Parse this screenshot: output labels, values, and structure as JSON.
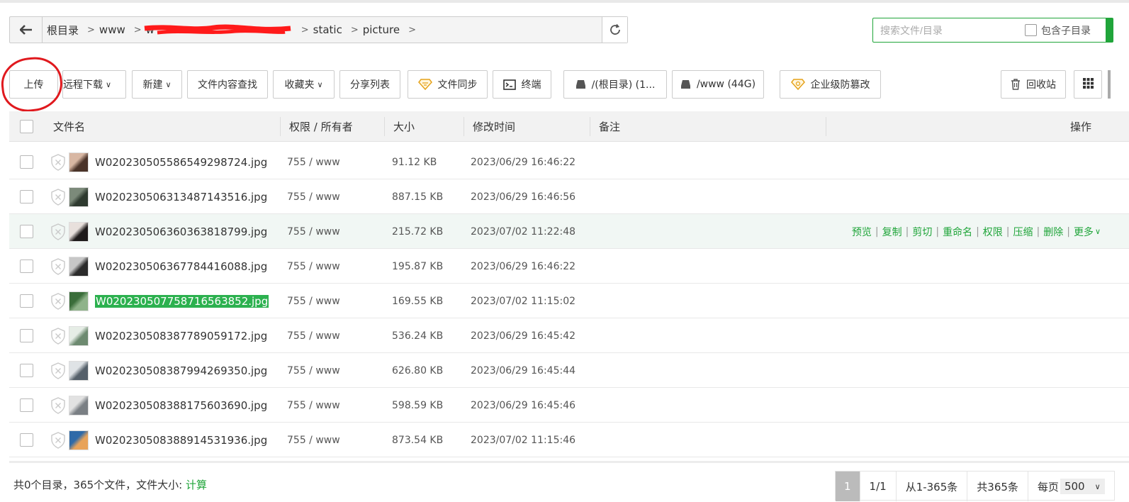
{
  "path": {
    "crumbs": [
      "根目录",
      "www",
      "w",
      "static",
      "picture"
    ]
  },
  "search": {
    "placeholder": "搜索文件/目录",
    "include_sub_label": "包含子目录"
  },
  "toolbar": {
    "upload": "上传",
    "remote_download": "远程下载",
    "new": "新建",
    "content_search": "文件内容查找",
    "favorites": "收藏夹",
    "share_list": "分享列表",
    "file_sync": "文件同步",
    "terminal": "终端",
    "disk_root": "/(根目录) (1...",
    "disk_www": "/www (44G)",
    "tamper": "企业级防篡改",
    "recycle": "回收站"
  },
  "table": {
    "headers": {
      "name": "文件名",
      "perm": "权限 / 所有者",
      "size": "大小",
      "mtime": "修改时间",
      "note": "备注",
      "ops": "操作"
    },
    "rows": [
      {
        "name": "W020230505586549298724.jpg",
        "perm": "755 / www",
        "size": "91.12 KB",
        "mtime": "2023/06/29 16:46:22"
      },
      {
        "name": "W020230506313487143516.jpg",
        "perm": "755 / www",
        "size": "887.15 KB",
        "mtime": "2023/06/29 16:46:56"
      },
      {
        "name": "W020230506360363818799.jpg",
        "perm": "755 / www",
        "size": "215.72 KB",
        "mtime": "2023/07/02 11:22:48"
      },
      {
        "name": "W020230506367784416088.jpg",
        "perm": "755 / www",
        "size": "195.87 KB",
        "mtime": "2023/06/29 16:46:22"
      },
      {
        "name": "W020230507758716563852.jpg",
        "perm": "755 / www",
        "size": "169.55 KB",
        "mtime": "2023/07/02 11:15:02"
      },
      {
        "name": "W020230508387789059172.jpg",
        "perm": "755 / www",
        "size": "536.24 KB",
        "mtime": "2023/06/29 16:45:42"
      },
      {
        "name": "W020230508387994269350.jpg",
        "perm": "755 / www",
        "size": "626.80 KB",
        "mtime": "2023/06/29 16:45:44"
      },
      {
        "name": "W020230508388175603690.jpg",
        "perm": "755 / www",
        "size": "598.59 KB",
        "mtime": "2023/06/29 16:45:46"
      },
      {
        "name": "W020230508388914531936.jpg",
        "perm": "755 / www",
        "size": "873.54 KB",
        "mtime": "2023/07/02 11:15:46"
      }
    ],
    "row_actions": [
      "预览",
      "复制",
      "剪切",
      "重命名",
      "权限",
      "压缩",
      "删除",
      "更多"
    ]
  },
  "footer": {
    "summary": "共0个目录，365个文件，文件大小: ",
    "calc": "计算",
    "page_current": "1",
    "page_total": "1/1",
    "range": "从1-365条",
    "total": "共365条",
    "per_page_label": "每页",
    "per_page_value": "500"
  },
  "colors": {
    "accent": "#20a53a",
    "annotation": "#e0191e"
  }
}
